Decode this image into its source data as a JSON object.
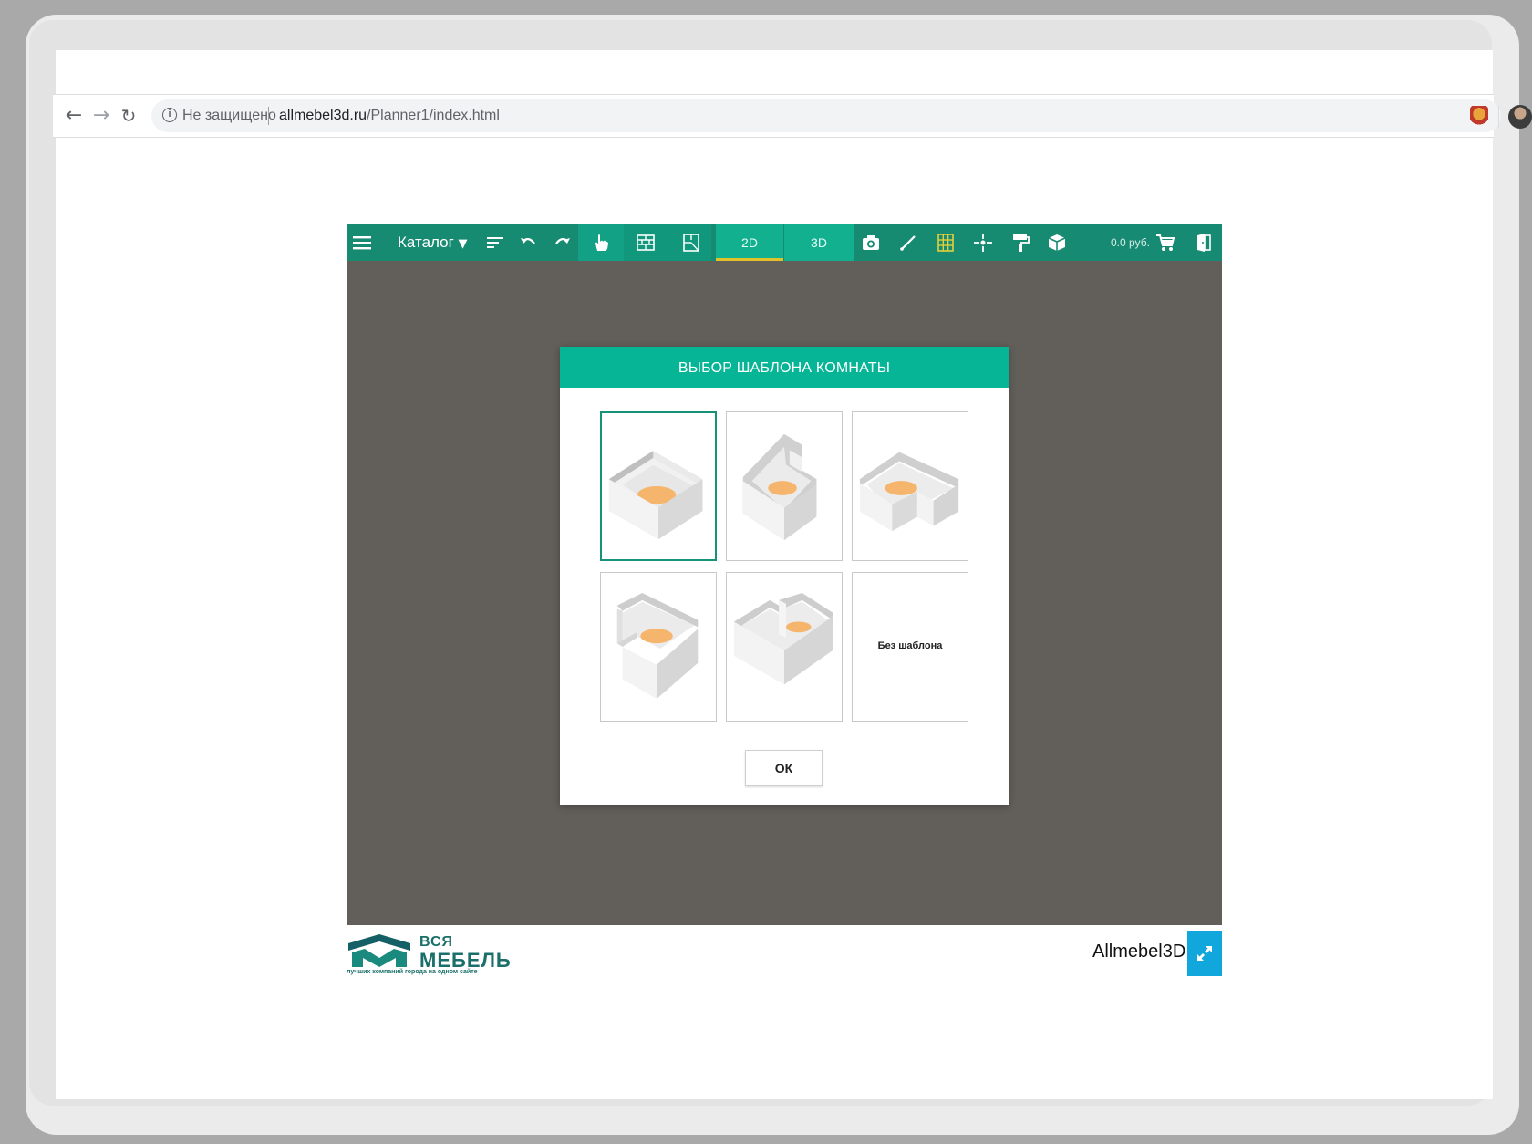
{
  "browser": {
    "security_label": "Не защищено",
    "url_host": "allmebel3d.ru",
    "url_path": "/Planner1/index.html",
    "icons": [
      "back-icon",
      "forward-icon",
      "reload-icon",
      "info-icon",
      "star-icon",
      "extension-icon",
      "profile-avatar",
      "menu-dots-icon"
    ]
  },
  "toolbar": {
    "catalog_label": "Каталог",
    "view_2d": "2D",
    "view_3d": "3D",
    "price": "0.0 руб.",
    "accent_color": "#178a72",
    "active_underline_color": "#e2c22a"
  },
  "dialog": {
    "title": "ВЫБОР ШАБЛОНА КОМНАТЫ",
    "templates": [
      {
        "name": "square-room",
        "selected": true
      },
      {
        "name": "room-notch-right",
        "selected": false
      },
      {
        "name": "l-shaped-room",
        "selected": false
      },
      {
        "name": "room-notch-left",
        "selected": false
      },
      {
        "name": "room-divided",
        "selected": false
      },
      {
        "name": "no-template",
        "selected": false,
        "label": "Без шаблона"
      }
    ],
    "ok_label": "ОК"
  },
  "footer": {
    "logo_line1": "ВСЯ",
    "logo_line2": "МЕБЕЛЬ",
    "logo_tagline": "лучших компаний города на одном сайте",
    "brand": "Allmebel3D"
  }
}
